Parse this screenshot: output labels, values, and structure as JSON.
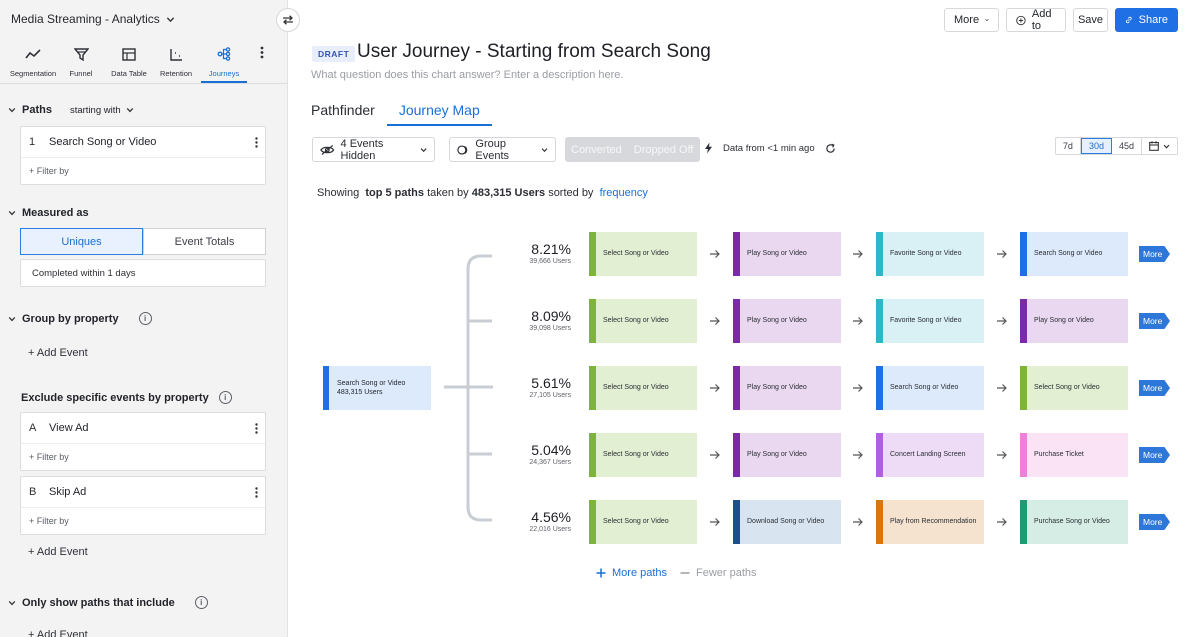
{
  "sidebar": {
    "app_title": "Media Streaming - Analytics",
    "report_tabs": [
      {
        "label": "Segmentation",
        "icon": "segmentation-icon"
      },
      {
        "label": "Funnel",
        "icon": "funnel-icon"
      },
      {
        "label": "Data Table",
        "icon": "data-table-icon"
      },
      {
        "label": "Retention",
        "icon": "retention-icon"
      },
      {
        "label": "Journeys",
        "icon": "journeys-icon",
        "active": true
      }
    ],
    "paths": {
      "label": "Paths",
      "mode": "starting with",
      "steps": [
        {
          "index": "1",
          "name": "Search Song or Video"
        }
      ],
      "filter_label": "+ Filter by"
    },
    "measured_as": {
      "label": "Measured as",
      "options": [
        "Uniques",
        "Event Totals"
      ],
      "selected": "Uniques",
      "completion": "Completed within 1 days"
    },
    "group_by": {
      "label": "Group by property",
      "add_label": "+ Add Event"
    },
    "exclude": {
      "label": "Exclude specific events by property",
      "events": [
        {
          "letter": "A",
          "name": "View Ad",
          "filter_label": "+ Filter by"
        },
        {
          "letter": "B",
          "name": "Skip Ad",
          "filter_label": "+ Filter by"
        }
      ],
      "add_label": "+ Add Event"
    },
    "only_show": {
      "label": "Only show paths that include",
      "add_label": "+ Add Event"
    }
  },
  "header": {
    "actions": {
      "more": "More",
      "add_to": "Add to",
      "save": "Save",
      "share": "Share"
    },
    "badge": "DRAFT",
    "title": "User Journey - Starting from Search Song",
    "description_placeholder": "What question does this chart answer? Enter a description here.",
    "view_tabs": [
      "Pathfinder",
      "Journey Map"
    ],
    "active_view": "Journey Map"
  },
  "controls": {
    "hidden_events": "4 Events Hidden",
    "group_events": "Group Events",
    "converted": "Converted",
    "dropped_off": "Dropped Off",
    "data_from": "Data from <1 min ago",
    "ranges": [
      "7d",
      "30d",
      "45d"
    ],
    "active_range": "30d"
  },
  "summary": {
    "prefix": "Showing",
    "paths": "top 5 paths",
    "mid": "taken by",
    "users": "483,315 Users",
    "sorted": "sorted by",
    "sort_key": "frequency"
  },
  "journey": {
    "start": {
      "name": "Search Song or Video",
      "users": "483,315 Users"
    },
    "event_colors": {
      "Select Song or Video": {
        "bg": "#e3efd3",
        "bar": "#7fb43a"
      },
      "Play Song or Video": {
        "bg": "#ead8f1",
        "bar": "#7a2aa8"
      },
      "Favorite Song or Video": {
        "bg": "#d9f1f5",
        "bar": "#2fb7c9"
      },
      "Search Song or Video": {
        "bg": "#dceafc",
        "bar": "#1f6fe5"
      },
      "Concert Landing Screen": {
        "bg": "#eedcf7",
        "bar": "#b25ee0"
      },
      "Purchase Ticket": {
        "bg": "#fbe3f6",
        "bar": "#ef7fd8"
      },
      "Download Song or Video": {
        "bg": "#d8e5f1",
        "bar": "#1e4f86"
      },
      "Play from Recommendation": {
        "bg": "#f5e3d0",
        "bar": "#d9760f"
      },
      "Purchase Song or Video": {
        "bg": "#d6ede5",
        "bar": "#1f9a73"
      }
    },
    "paths": [
      {
        "percent": "8.21%",
        "users": "39,666 Users",
        "steps": [
          "Select Song or Video",
          "Play Song or Video",
          "Favorite Song or Video",
          "Search Song or Video"
        ],
        "more": "More"
      },
      {
        "percent": "8.09%",
        "users": "39,098 Users",
        "steps": [
          "Select Song or Video",
          "Play Song or Video",
          "Favorite Song or Video",
          "Play Song or Video"
        ],
        "more": "More"
      },
      {
        "percent": "5.61%",
        "users": "27,105 Users",
        "steps": [
          "Select Song or Video",
          "Play Song or Video",
          "Search Song or Video",
          "Select Song or Video"
        ],
        "more": "More"
      },
      {
        "percent": "5.04%",
        "users": "24,367 Users",
        "steps": [
          "Select Song or Video",
          "Play Song or Video",
          "Concert Landing Screen",
          "Purchase Ticket"
        ],
        "more": "More"
      },
      {
        "percent": "4.56%",
        "users": "22,016 Users",
        "steps": [
          "Select Song or Video",
          "Download Song or Video",
          "Play from Recommendation",
          "Purchase Song or Video"
        ],
        "more": "More"
      }
    ],
    "more_paths": "More paths",
    "fewer_paths": "Fewer paths"
  }
}
